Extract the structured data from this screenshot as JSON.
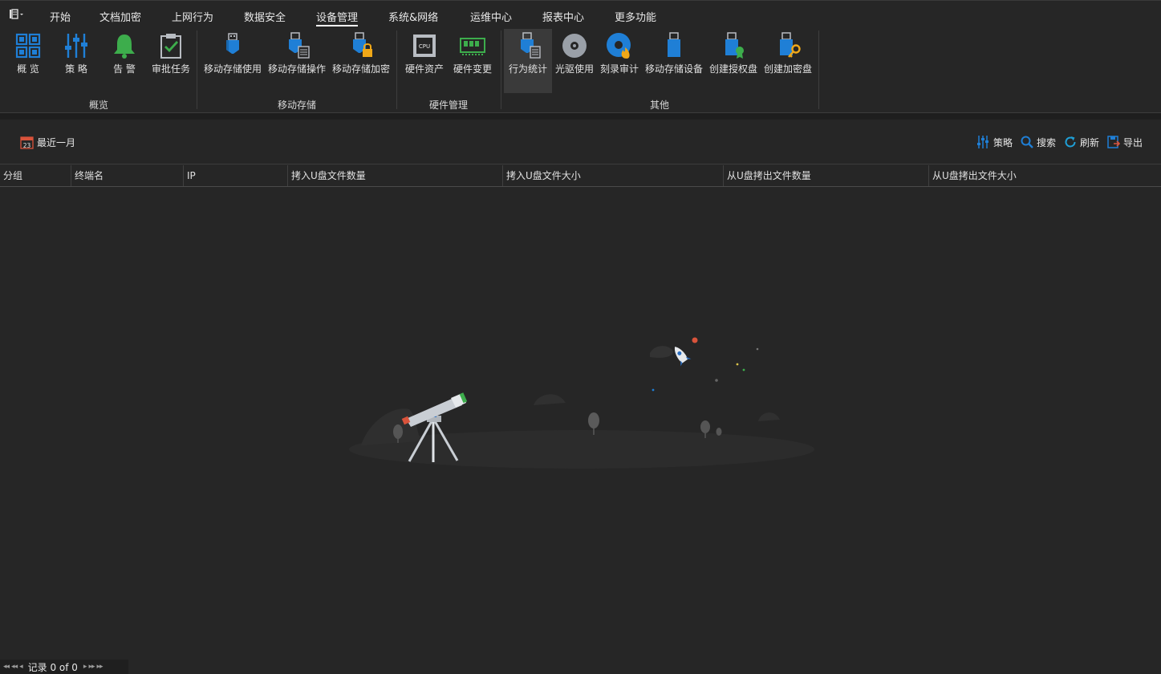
{
  "menubar": {
    "tabs": [
      "开始",
      "文档加密",
      "上网行为",
      "数据安全",
      "设备管理",
      "系统&网络",
      "运维中心",
      "报表中心",
      "更多功能"
    ],
    "active_tab": "设备管理"
  },
  "ribbon": {
    "groups": [
      {
        "label": "概览",
        "buttons": [
          "概 览",
          "策 略",
          "告 警",
          "审批任务"
        ]
      },
      {
        "label": "移动存储",
        "buttons": [
          "移动存储使用",
          "移动存储操作",
          "移动存储加密"
        ]
      },
      {
        "label": "硬件管理",
        "buttons": [
          "硬件资产",
          "硬件变更"
        ]
      },
      {
        "label": "其他",
        "buttons": [
          "行为统计",
          "光驱使用",
          "刻录审计",
          "移动存储设备",
          "创建授权盘",
          "创建加密盘"
        ]
      }
    ],
    "active_button": "行为统计"
  },
  "toolbar": {
    "date_range": "最近一月",
    "calendar_day": "23",
    "policy": "策略",
    "search": "搜索",
    "refresh": "刷新",
    "export": "导出"
  },
  "table": {
    "columns": [
      "分组",
      "终端名",
      "IP",
      "拷入U盘文件数量",
      "拷入U盘文件大小",
      "从U盘拷出文件数量",
      "从U盘拷出文件大小"
    ],
    "rows": []
  },
  "pager": {
    "text": "记录 0 of 0"
  },
  "colors": {
    "background": "#262626",
    "icon_blue": "#1f7fd6",
    "icon_green": "#3dad4c",
    "icon_gray": "#b8bcc2",
    "icon_gold": "#f0a818"
  }
}
